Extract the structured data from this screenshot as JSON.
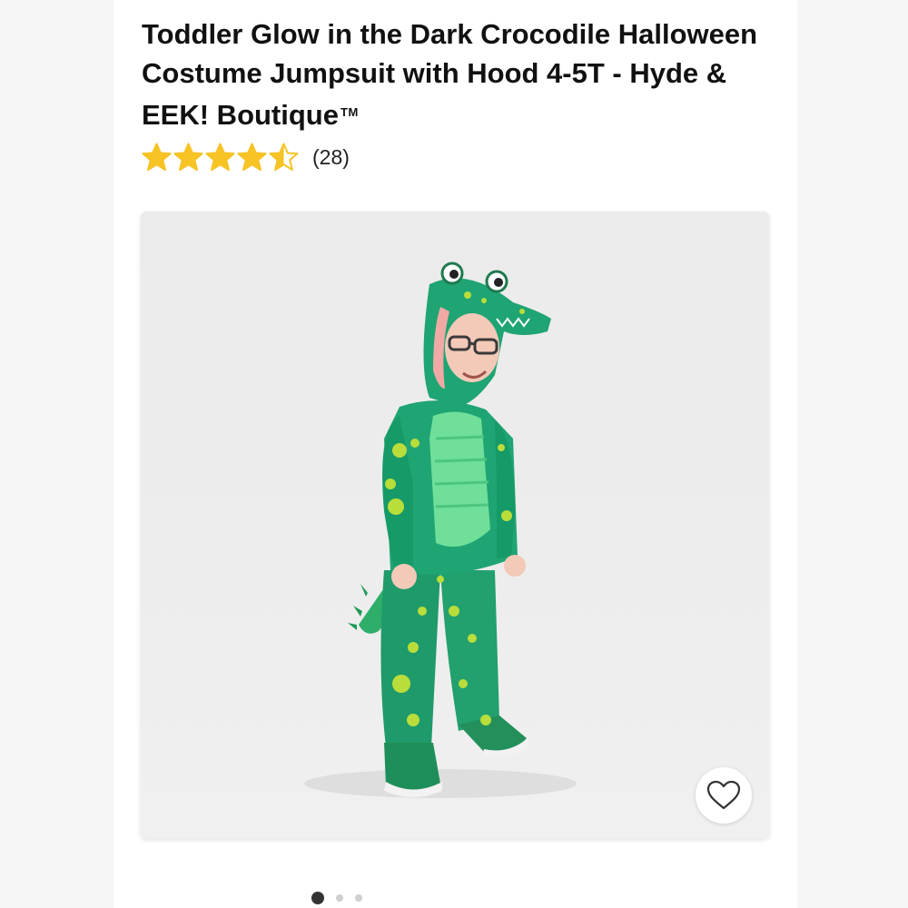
{
  "product": {
    "title": "Toddler Glow in the Dark Crocodile Halloween Costume Jumpsuit with Hood 4-5T - Hyde & EEK! Boutique",
    "trademark": "TM",
    "rating": 4.5,
    "rating_max": 5,
    "review_count": "(28)",
    "star_color": "#f7c325",
    "image_icon": "crocodile-costume-photo"
  },
  "gallery": {
    "total_images": 3,
    "active_index": 0
  },
  "actions": {
    "favorite_icon": "heart-outline-icon"
  }
}
